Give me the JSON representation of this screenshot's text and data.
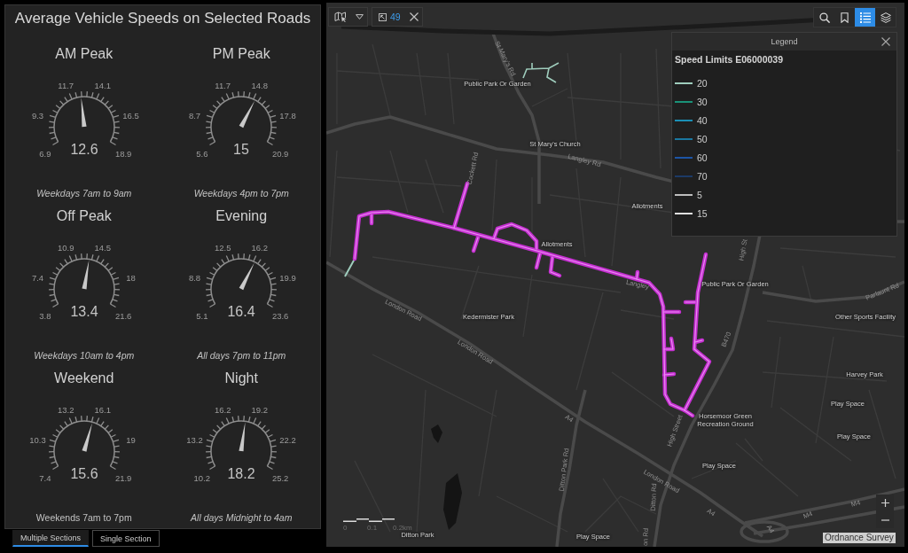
{
  "panel": {
    "title": "Average Vehicle Speeds on Selected Roads",
    "gauges": [
      {
        "title": "AM Peak",
        "ticks": [
          "6.9",
          "9.3",
          "11.7",
          "14.1",
          "16.5",
          "18.9"
        ],
        "reading": "12.6",
        "level": 0.475,
        "caption": "Weekdays 7am to 9am",
        "caption_italic": true
      },
      {
        "title": "PM Peak",
        "ticks": [
          "5.6",
          "8.7",
          "11.7",
          "14.8",
          "17.8",
          "20.9"
        ],
        "reading": "15",
        "level": 0.614,
        "caption": "Weekdays 4pm to 7pm",
        "caption_italic": true
      },
      {
        "title": "Off Peak",
        "ticks": [
          "3.8",
          "7.4",
          "10.9",
          "14.5",
          "18",
          "21.6"
        ],
        "reading": "13.4",
        "level": 0.539,
        "caption": "Weekdays 10am to 4pm",
        "caption_italic": true
      },
      {
        "title": "Evening",
        "ticks": [
          "5.1",
          "8.8",
          "12.5",
          "16.2",
          "19.9",
          "23.6"
        ],
        "reading": "16.4",
        "level": 0.611,
        "caption": "All days 7pm to 11pm",
        "caption_italic": true
      },
      {
        "title": "Weekend",
        "ticks": [
          "7.4",
          "10.3",
          "13.2",
          "16.1",
          "19",
          "21.9"
        ],
        "reading": "15.6",
        "level": 0.566,
        "caption": "Weekends 7am to 7pm",
        "caption_italic": false
      },
      {
        "title": "Night",
        "ticks": [
          "10.2",
          "13.2",
          "16.2",
          "19.2",
          "22.2",
          "25.2"
        ],
        "reading": "18.2",
        "level": 0.533,
        "caption": "All days Midnight to 4am",
        "caption_italic": true
      }
    ]
  },
  "section_tabs": [
    {
      "label": "Multiple Sections",
      "selected": true
    },
    {
      "label": "Single Section",
      "selected": false
    }
  ],
  "map": {
    "toolbar": {
      "selection_count": "49"
    },
    "tools": [
      {
        "kind": "search",
        "selected": false
      },
      {
        "kind": "bookmarks",
        "selected": false
      },
      {
        "kind": "legend",
        "selected": true
      },
      {
        "kind": "layers",
        "selected": false
      }
    ],
    "legend": {
      "title": "Legend",
      "layer": "Speed Limits E06000039",
      "items": [
        {
          "label": "20",
          "color": "#9fcdbd"
        },
        {
          "label": "30",
          "color": "#1a9278"
        },
        {
          "label": "40",
          "color": "#1b8fb5"
        },
        {
          "label": "50",
          "color": "#1a77a0"
        },
        {
          "label": "60",
          "color": "#1c55a6"
        },
        {
          "label": "70",
          "color": "#1c3a66"
        },
        {
          "label": "5",
          "color": "#bdbdbd"
        },
        {
          "label": "15",
          "color": "#e0e0e0"
        }
      ]
    },
    "labels": [
      {
        "text": "St Mary's Rd",
        "kind": "road"
      },
      {
        "text": "Public Park Or Garden",
        "kind": "place"
      },
      {
        "text": "St Mary's Church",
        "kind": "place"
      },
      {
        "text": "Cockett Rd",
        "kind": "road"
      },
      {
        "text": "Langley Rd",
        "kind": "road"
      },
      {
        "text": "Allotments",
        "kind": "place"
      },
      {
        "text": "Allotments",
        "kind": "place"
      },
      {
        "text": "High St",
        "kind": "road"
      },
      {
        "text": "Langley",
        "kind": "road"
      },
      {
        "text": "Public Park Or Garden",
        "kind": "place"
      },
      {
        "text": "Parlaunt Rd",
        "kind": "road"
      },
      {
        "text": "London Road",
        "kind": "road"
      },
      {
        "text": "Kedermister Park",
        "kind": "place"
      },
      {
        "text": "Other Sports Facility",
        "kind": "place"
      },
      {
        "text": "London Road",
        "kind": "road"
      },
      {
        "text": "B470",
        "kind": "road"
      },
      {
        "text": "Harvey Park",
        "kind": "place"
      },
      {
        "text": "Play Space",
        "kind": "place"
      },
      {
        "text": "A4",
        "kind": "road"
      },
      {
        "text": "High Street",
        "kind": "road"
      },
      {
        "text": "Horsemoor Green Recreation Ground",
        "kind": "place"
      },
      {
        "text": "Play Space",
        "kind": "place"
      },
      {
        "text": "Ditton Park Rd",
        "kind": "road"
      },
      {
        "text": "Play Space",
        "kind": "place"
      },
      {
        "text": "London Road",
        "kind": "road"
      },
      {
        "text": "Ditton Rd",
        "kind": "road"
      },
      {
        "text": "A4",
        "kind": "road"
      },
      {
        "text": "M4",
        "kind": "road"
      },
      {
        "text": "M4",
        "kind": "road"
      },
      {
        "text": "Ditton Park",
        "kind": "place"
      },
      {
        "text": "Play Space",
        "kind": "place"
      },
      {
        "text": "on Rd",
        "kind": "road"
      },
      {
        "text": "A4",
        "kind": "road"
      }
    ],
    "scale": [
      "0",
      "0.1",
      "0.2km"
    ],
    "attribution": "Ordnance Survey"
  }
}
